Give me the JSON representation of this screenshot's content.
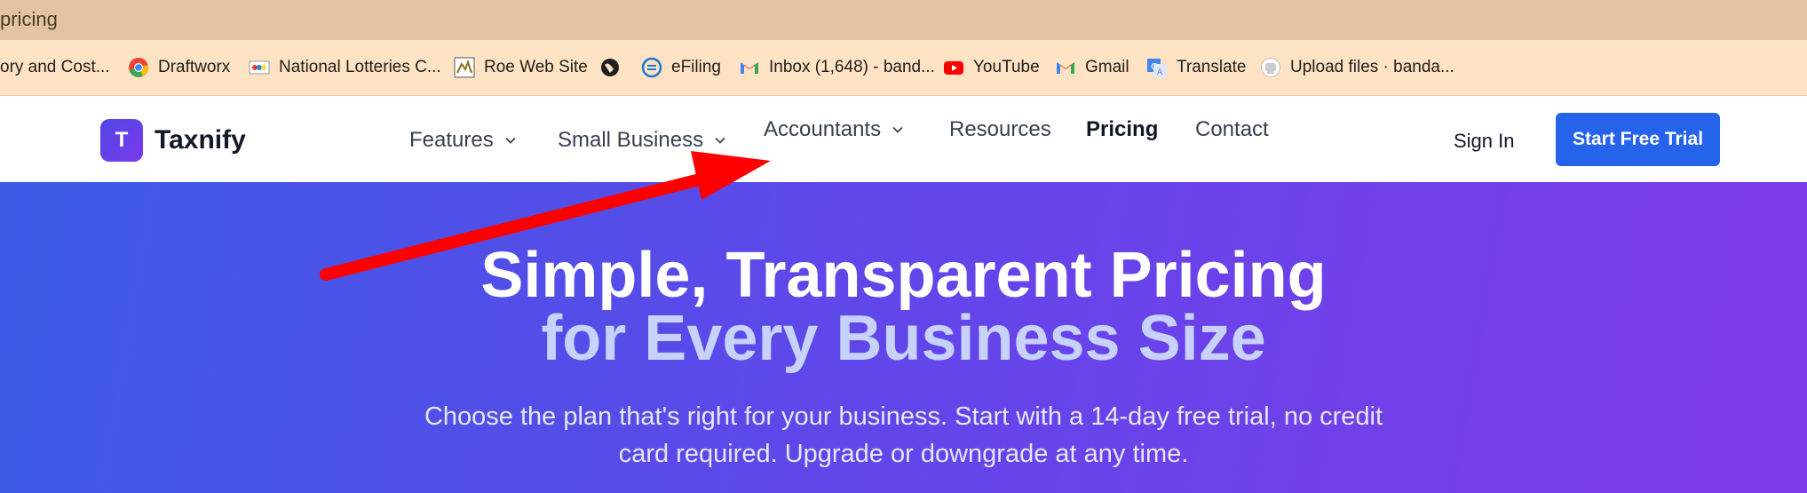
{
  "browser": {
    "tab_title": "pricing",
    "bookmarks": [
      {
        "label": "ory and Cost...",
        "icon": "none"
      },
      {
        "label": "Draftworx",
        "icon": "chrome-icon"
      },
      {
        "label": "National Lotteries C...",
        "icon": "lottery-icon"
      },
      {
        "label": "Roe Web Site",
        "icon": "roe-icon"
      },
      {
        "label": "",
        "icon": "globe-icon"
      },
      {
        "label": "eFiling",
        "icon": "efiling-icon"
      },
      {
        "label": "Inbox (1,648) - band...",
        "icon": "gmail-icon"
      },
      {
        "label": "YouTube",
        "icon": "youtube-icon"
      },
      {
        "label": "Gmail",
        "icon": "gmail-icon"
      },
      {
        "label": "Translate",
        "icon": "translate-icon"
      },
      {
        "label": "Upload files · banda...",
        "icon": "github-icon"
      }
    ]
  },
  "nav": {
    "logo_letter": "T",
    "brand": "Taxnify",
    "items": [
      {
        "label": "Features",
        "dropdown": true
      },
      {
        "label": "Small Business",
        "dropdown": true
      },
      {
        "label": "Accountants",
        "dropdown": true
      },
      {
        "label": "Resources",
        "dropdown": false
      },
      {
        "label": "Pricing",
        "dropdown": false,
        "active": true
      },
      {
        "label": "Contact",
        "dropdown": false
      }
    ],
    "sign_in": "Sign In",
    "cta": "Start Free Trial"
  },
  "hero": {
    "title_line1": "Simple, Transparent Pricing",
    "title_line2": "for Every Business Size",
    "subtitle_line1": "Choose the plan that's right for your business. Start with a 14-day free trial, no credit",
    "subtitle_line2": "card required. Upgrade or downgrade at any time."
  },
  "colors": {
    "primary": "#2563eb",
    "hero_gradient_start": "#3b5be5",
    "hero_gradient_end": "#7e3ae8",
    "annotation_arrow": "#ff0000"
  }
}
